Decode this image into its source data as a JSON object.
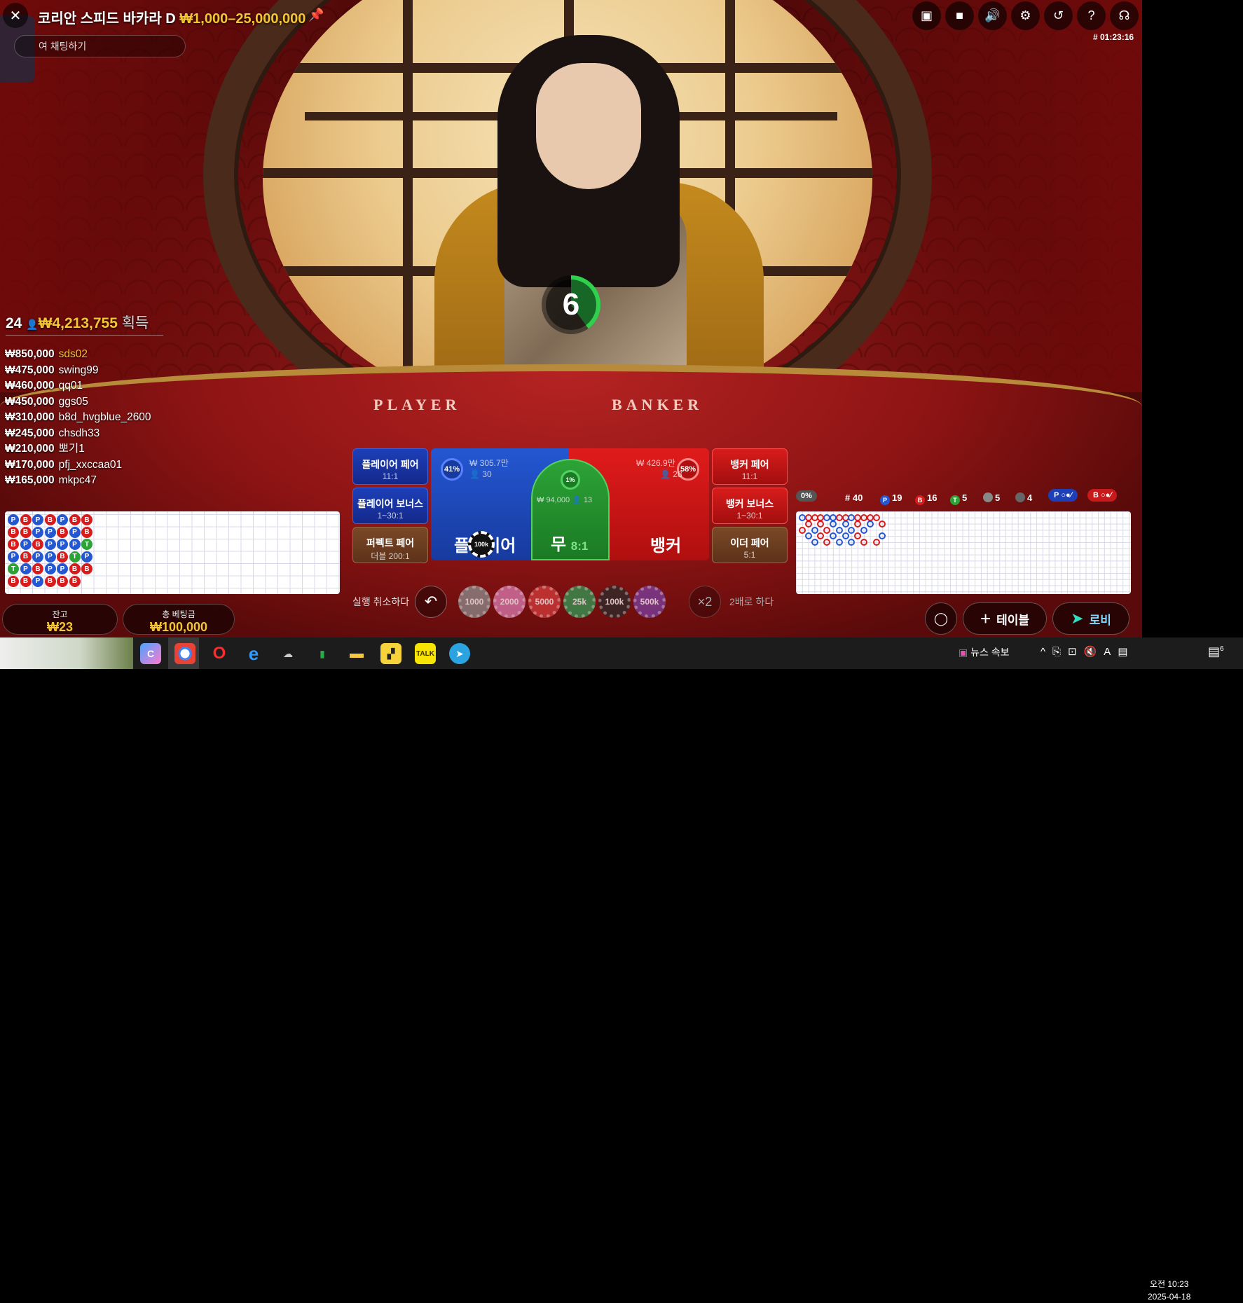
{
  "game": {
    "title": "코리안 스피드 바카라 D",
    "limits": "₩1,000–25,000,000",
    "chat_placeholder": "여 채팅하기",
    "round_id": "# 01:23:16"
  },
  "toolbar": [
    "chat-icon",
    "video-icon",
    "volume-icon",
    "settings-icon",
    "history-icon",
    "help-icon",
    "headset-icon"
  ],
  "timer": {
    "value": "6",
    "progress": 0.4
  },
  "table_labels": {
    "player": "PLAYER",
    "banker": "BANKER"
  },
  "winners": {
    "count": "24",
    "total": "₩4,213,755",
    "suffix": "획득",
    "list": [
      {
        "amount": "₩850,000",
        "name": "sds02"
      },
      {
        "amount": "₩475,000",
        "name": "swing99"
      },
      {
        "amount": "₩460,000",
        "name": "qq01"
      },
      {
        "amount": "₩450,000",
        "name": "ggs05"
      },
      {
        "amount": "₩310,000",
        "name": "b8d_hvgblue_2600"
      },
      {
        "amount": "₩245,000",
        "name": "chsdh33"
      },
      {
        "amount": "₩210,000",
        "name": "뽀기1"
      },
      {
        "amount": "₩170,000",
        "name": "pfj_xxccaa01"
      },
      {
        "amount": "₩165,000",
        "name": "mkpc47"
      }
    ]
  },
  "bead_road": [
    [
      "P",
      "B",
      "B",
      "P",
      "T",
      "B"
    ],
    [
      "B",
      "B",
      "P",
      "B",
      "P",
      "B"
    ],
    [
      "P",
      "P",
      "B",
      "P",
      "B",
      "P"
    ],
    [
      "B",
      "P",
      "P",
      "P",
      "P",
      "B"
    ],
    [
      "P",
      "B",
      "P",
      "B",
      "P",
      "B"
    ],
    [
      "B",
      "P",
      "P",
      "T",
      "B",
      "B"
    ],
    [
      "B",
      "B",
      "T",
      "P",
      "B"
    ]
  ],
  "balance": {
    "label": "잔고",
    "value": "₩23"
  },
  "total_bet": {
    "label": "총 베팅금",
    "value": "₩100,000"
  },
  "bets": {
    "player_pair": {
      "label": "플레이어 페어",
      "odds": "11:1"
    },
    "player_bonus": {
      "label": "플레이어 보너스",
      "odds": "1~30:1"
    },
    "perfect_pair": {
      "label": "퍼펙트 페어",
      "odds": "더블 200:1"
    },
    "banker_pair": {
      "label": "뱅커 페어",
      "odds": "11:1"
    },
    "banker_bonus": {
      "label": "뱅커 보너스",
      "odds": "1~30:1"
    },
    "either_pair": {
      "label": "이더 페어",
      "odds": "5:1"
    },
    "player": {
      "label": "플레이어",
      "pct": "41%",
      "amount": "₩ 305.7만",
      "players": "30"
    },
    "tie": {
      "label": "무",
      "odds": "8:1",
      "pct": "1%",
      "amount": "₩ 94,000",
      "players": "13"
    },
    "banker": {
      "label": "뱅커",
      "pct": "58%",
      "amount": "₩ 426.9만",
      "players": "28"
    },
    "placed_chip": "100k"
  },
  "chips": {
    "undo_label": "실행 취소하다",
    "values": [
      "1000",
      "2000",
      "5000",
      "25k",
      "100k",
      "500k"
    ],
    "colors": [
      "#8c8c8c",
      "#d97ab0",
      "#d23b3b",
      "#2f9a55",
      "#2b2b2b",
      "#7a3fa0"
    ],
    "double_label": "×2",
    "double_text": "2배로 하다"
  },
  "stats": {
    "percent": "0%",
    "rounds": "# 40",
    "player": "19",
    "banker": "16",
    "tie": "5",
    "player_pair": "5",
    "banker_pair": "4",
    "p_ask": "P",
    "b_ask": "B"
  },
  "buttons": {
    "table": "테이블",
    "lobby": "로비"
  },
  "taskbar": {
    "news": "뉴스 속보",
    "time_line1": "오전 10:23",
    "time_line2": "2025-04-18",
    "notif": "6"
  },
  "colors": {
    "player": "#2457d2",
    "banker": "#d81c1c",
    "tie": "#2ca337",
    "gold": "#f7c531"
  }
}
